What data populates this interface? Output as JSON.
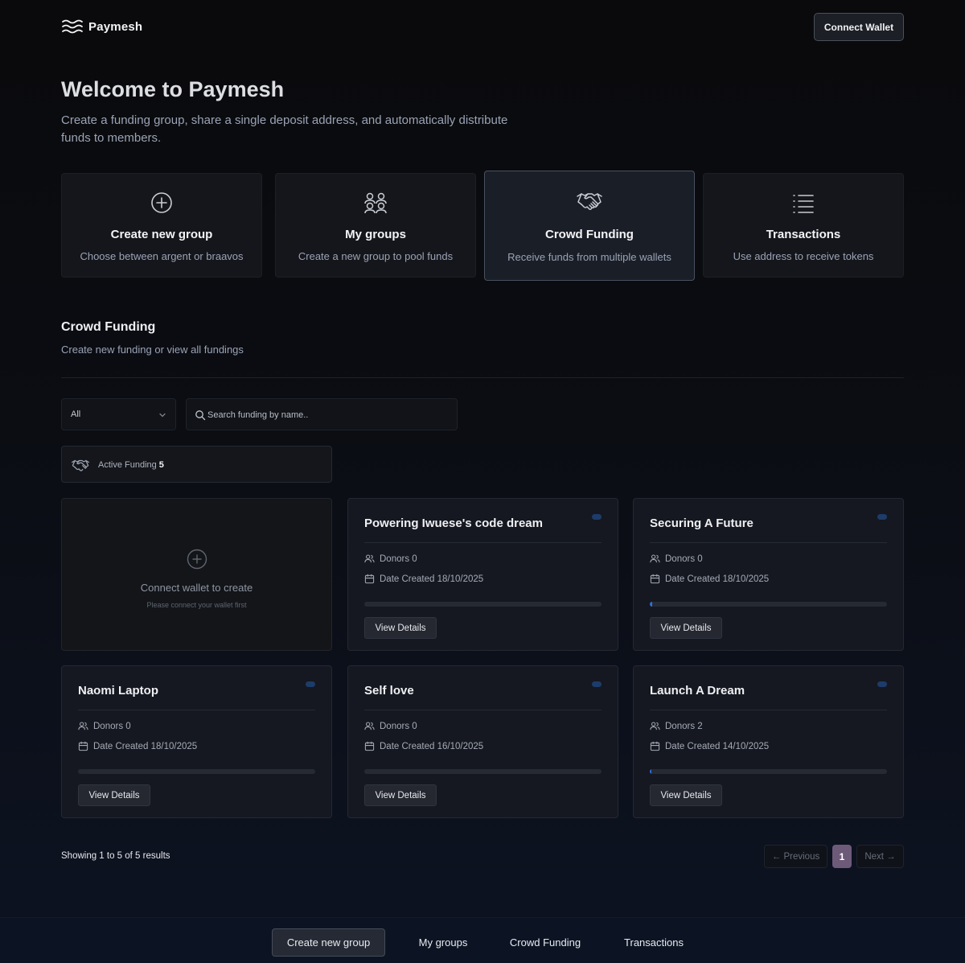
{
  "header": {
    "logo_text": "Paymesh",
    "logo_icon": "waves-icon",
    "connect_label": "Connect Wallet"
  },
  "hero": {
    "title": "Welcome to Paymesh",
    "subtitle": "Create a funding group, share a single deposit address, and automatically distribute funds to members."
  },
  "features": [
    {
      "icon": "plus-circle-icon",
      "title": "Create new group",
      "subtitle": "Choose between argent or braavos"
    },
    {
      "icon": "users-group-icon",
      "title": "My groups",
      "subtitle": "Create a new group to pool funds"
    },
    {
      "icon": "handshake-icon",
      "title": "Crowd Funding",
      "subtitle": "Receive funds from multiple wallets"
    },
    {
      "icon": "list-icon",
      "title": "Transactions",
      "subtitle": "Use address to receive tokens"
    }
  ],
  "section": {
    "title": "Crowd Funding",
    "subtitle": "Create new funding or view all fundings"
  },
  "filters": {
    "select_value": "All",
    "search_placeholder": "Search funding by name.."
  },
  "active": {
    "label": "Active Funding",
    "count": "5"
  },
  "empty_card": {
    "title": "Connect wallet to create",
    "subtitle": "Please connect your wallet first"
  },
  "cards": [
    {
      "title": "Powering Iwuese's code dream",
      "donors": "Donors 0",
      "date": "Date Created 18/10/2025",
      "progress": 0,
      "button": "View Details"
    },
    {
      "title": "Securing A Future",
      "donors": "Donors 0",
      "date": "Date Created 18/10/2025",
      "progress": 0.01,
      "button": "View Details"
    },
    {
      "title": "Naomi Laptop",
      "donors": "Donors 0",
      "date": "Date Created 18/10/2025",
      "progress": 0,
      "button": "View Details"
    },
    {
      "title": "Self love",
      "donors": "Donors 0",
      "date": "Date Created 16/10/2025",
      "progress": 0,
      "button": "View Details"
    },
    {
      "title": "Launch A Dream",
      "donors": "Donors 2",
      "date": "Date Created 14/10/2025",
      "progress": 0.005,
      "button": "View Details"
    }
  ],
  "pagination": {
    "showing": "Showing 1 to 5 of 5 results",
    "prev": "← Previous",
    "page": "1",
    "next": "Next →"
  },
  "bottom_nav": [
    "Create new group",
    "My groups",
    "Crowd Funding",
    "Transactions"
  ],
  "colors": {
    "accent": "#2f6fe0",
    "page_badge": "#6d5a79"
  }
}
